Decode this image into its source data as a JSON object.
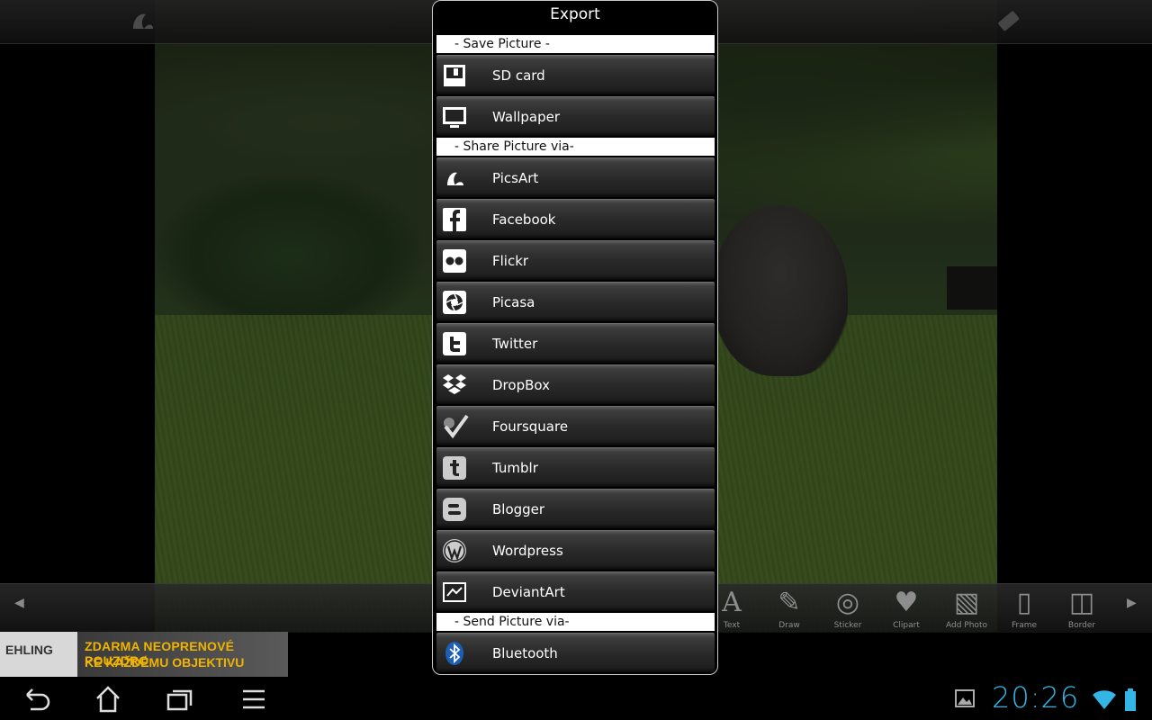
{
  "dialog": {
    "title": "Export",
    "sections": {
      "save": "- Save Picture -",
      "share": "- Share Picture via-",
      "send": "- Send Picture via-"
    },
    "items": [
      {
        "label": "SD card",
        "icon": "floppy-disk-icon"
      },
      {
        "label": "Wallpaper",
        "icon": "monitor-icon"
      },
      {
        "label": "PicsArt",
        "icon": "picsart-icon"
      },
      {
        "label": "Facebook",
        "icon": "facebook-icon"
      },
      {
        "label": "Flickr",
        "icon": "flickr-icon"
      },
      {
        "label": "Picasa",
        "icon": "picasa-icon"
      },
      {
        "label": "Twitter",
        "icon": "twitter-icon"
      },
      {
        "label": "DropBox",
        "icon": "dropbox-icon"
      },
      {
        "label": "Foursquare",
        "icon": "foursquare-icon"
      },
      {
        "label": "Tumblr",
        "icon": "tumblr-icon"
      },
      {
        "label": "Blogger",
        "icon": "blogger-icon"
      },
      {
        "label": "Wordpress",
        "icon": "wordpress-icon"
      },
      {
        "label": "DeviantArt",
        "icon": "deviantart-icon"
      },
      {
        "label": "Bluetooth",
        "icon": "bluetooth-icon"
      }
    ]
  },
  "toolbar": {
    "tools": [
      {
        "label": "Text",
        "icon": "text-icon"
      },
      {
        "label": "Draw",
        "icon": "pencil-icon"
      },
      {
        "label": "Sticker",
        "icon": "sticker-icon"
      },
      {
        "label": "Clipart",
        "icon": "heart-star-icon"
      },
      {
        "label": "Add Photo",
        "icon": "add-photo-icon"
      },
      {
        "label": "Frame",
        "icon": "frame-icon"
      },
      {
        "label": "Border",
        "icon": "border-icon"
      }
    ]
  },
  "ad": {
    "brand": "EHLING",
    "line1": "ZDARMA NEOPRENOVÉ POUZDRO",
    "line2": "KE KAŽDÉMU OBJEKTIVU"
  },
  "status": {
    "clock": "20:26",
    "accent_color": "#33b5e5"
  }
}
